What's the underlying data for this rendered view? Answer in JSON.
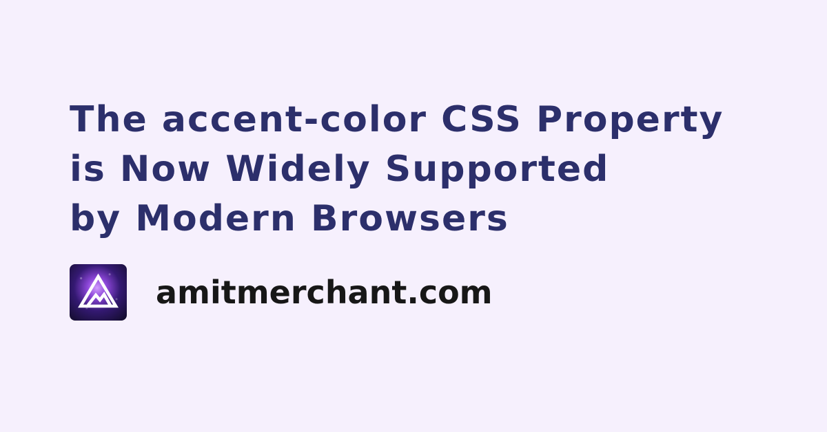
{
  "title": {
    "lines": [
      "The accent-color CSS Property",
      "is Now Widely Supported",
      "by Modern Browsers"
    ]
  },
  "brand": {
    "site": "amitmerchant.com",
    "logo_icon": "mountain-triangle-icon"
  },
  "colors": {
    "background": "#f6f0fd",
    "title": "#2c2f6b",
    "site": "#171717",
    "logo_dark": "#0f0b24",
    "logo_purple": "#8c46d8"
  }
}
